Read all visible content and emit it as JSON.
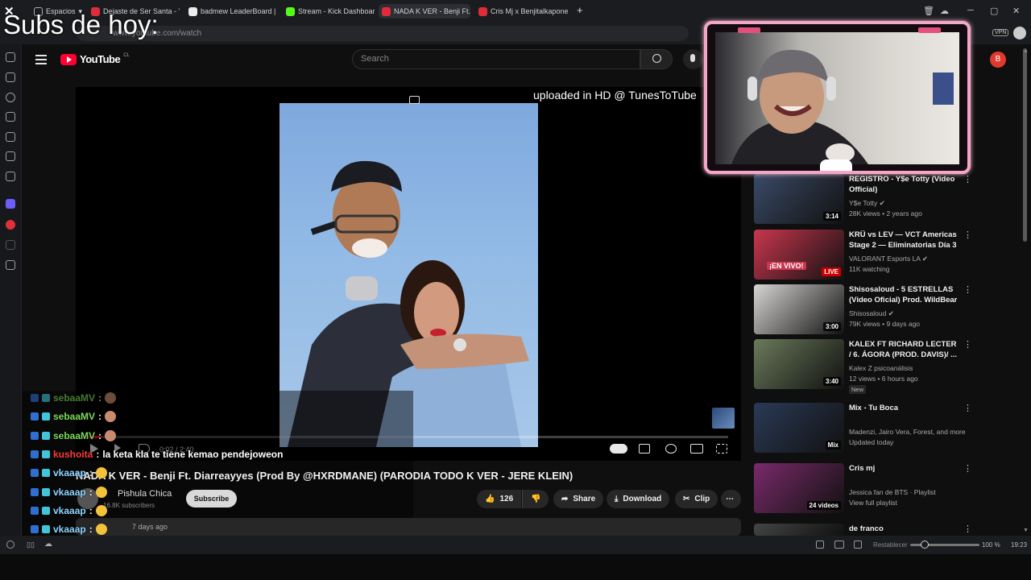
{
  "browser": {
    "tabs": [
      {
        "label": "Espacios",
        "color": "#1b1c1f"
      },
      {
        "label": "Dejaste de Ser Santa - You",
        "color": "#e02b3a"
      },
      {
        "label": "badmew LeaderBoard | The",
        "color": "#ececec"
      },
      {
        "label": "Stream - Kick Dashboard",
        "color": "#53fc18"
      },
      {
        "label": "NADA K VER - Benji Ft. Dia",
        "color": "#e02b3a"
      },
      {
        "label": "Cris Mj x Benjitalkapone - Y",
        "color": "#e02b3a"
      }
    ],
    "new_tab": "+",
    "url": "www.youtube.com/watch",
    "vpn": "VPN"
  },
  "overlay": {
    "subs_text": "Subs de hoy:"
  },
  "youtube": {
    "logo_text": "YouTube",
    "country": "CL",
    "search_placeholder": "Search",
    "avatar_letter": "B",
    "player": {
      "watermark": "uploaded in HD @ TunesToTube",
      "timecode": "0:02 / 2:40",
      "progress": 0.02
    },
    "video_title": "NADA K VER - Benji Ft. Diarreayyes (Prod By @HXRDMANE) (PARODIA TODO K VER - JERE KLEIN)",
    "channel_name": "Pishula Chica",
    "subscribers": "16.8K subscribers",
    "subscribe_label": "Subscribe",
    "likes": "126",
    "share_label": "Share",
    "download_label": "Download",
    "clip_label": "Clip",
    "upload_age": "7 days ago"
  },
  "recommendations": [
    {
      "title": "REGISTRO - Y$e Totty (Video Official)",
      "channel": "Y$e Totty",
      "meta": "28K views • 2 years ago",
      "duration": "3:14",
      "thumb_color": "#3a4a66",
      "verified": true
    },
    {
      "title": "KRÜ vs LEV — VCT Americas Stage 2 — Eliminatorias Día 3",
      "channel": "VALORANT Esports LA",
      "meta": "11K watching",
      "duration": "LIVE",
      "live_text": "¡EN VIVO!",
      "thumb_color": "#c9364e",
      "verified": true
    },
    {
      "title": "Shisosaloud - 5 ESTRELLAS (Video Oficial) Prod. WildBear",
      "channel": "Shisosaloud",
      "meta": "79K views • 9 days ago",
      "duration": "3:00",
      "thumb_color": "#d8d6d4",
      "verified": true
    },
    {
      "title": "KALEX FT RICHARD LECTER / 6. ÁGORA (PROD. DAVIS)/ ...",
      "channel": "Kalex Z psicoanálisis",
      "meta": "12 views • 6 hours ago",
      "duration": "3:40",
      "badge": "New",
      "thumb_color": "#6a7a5a",
      "verified": false
    },
    {
      "title": "Mix - Tu Boca",
      "channel": "Madenzi, Jairo Vera, Forest, and more",
      "meta": "Updated today",
      "duration": "Mix",
      "thumb_color": "#2a3a55",
      "verified": false
    },
    {
      "title": "Cris mj",
      "channel": "Jessica fan de BTS · Playlist",
      "meta": "View full playlist",
      "duration": "24 videos",
      "thumb_color": "#7a2a6a",
      "verified": false
    },
    {
      "title": "de franco",
      "channel": "",
      "meta": "",
      "duration": "",
      "thumb_color": "#444",
      "verified": false
    }
  ],
  "chat": [
    {
      "user": "sebaaMV",
      "message": "",
      "user_color": "#7ed957",
      "dim": true
    },
    {
      "user": "sebaaMV",
      "message": "",
      "user_color": "#7ed957",
      "dim": false
    },
    {
      "user": "sebaaMV",
      "message": "",
      "user_color": "#7ed957",
      "dim": false
    },
    {
      "user": "kushoita",
      "message": "la keta kla te tiene kemao pendejoweon",
      "user_color": "#ff3b3b",
      "dim": false
    },
    {
      "user": "vkaaap",
      "message": "",
      "user_color": "#8fd3ff",
      "dim": false
    },
    {
      "user": "vkaaap",
      "message": "",
      "user_color": "#8fd3ff",
      "dim": false
    },
    {
      "user": "vkaaap",
      "message": "",
      "user_color": "#8fd3ff",
      "dim": false
    },
    {
      "user": "vkaaap",
      "message": "",
      "user_color": "#8fd3ff",
      "dim": false
    }
  ],
  "statusbar": {
    "reset_label": "Restablecer",
    "zoom": "100 %",
    "clock": "19:23"
  }
}
